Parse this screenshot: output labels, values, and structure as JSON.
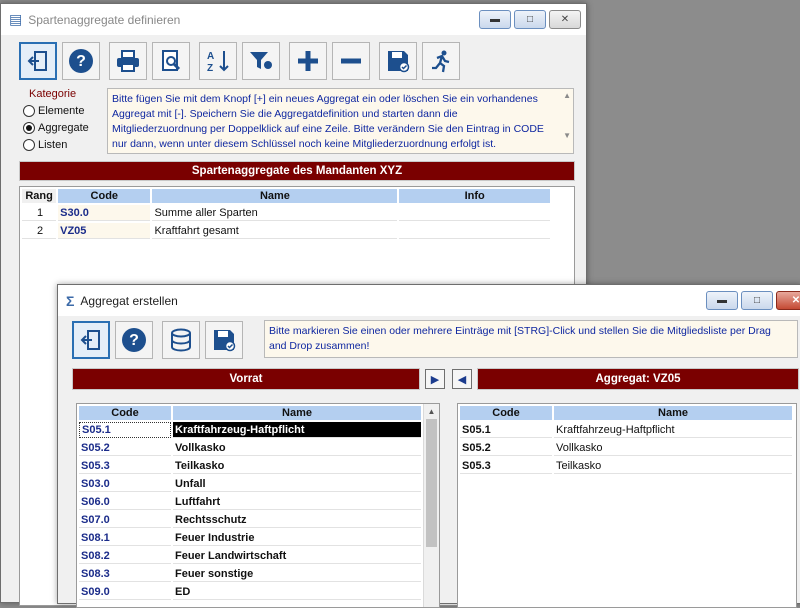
{
  "win1": {
    "title": "Spartenaggregate definieren",
    "help": "Bitte fügen Sie mit dem Knopf [+] ein neues Aggregat ein oder löschen Sie ein vorhandenes Aggregat mit [-]. Speichern Sie die Aggregatdefinition und starten dann die Mitgliederzuordnung per Doppelklick auf eine Zeile. Bitte verändern Sie den Eintrag in CODE nur dann, wenn unter diesem Schlüssel noch keine Mitgliederzuordnung erfolgt ist.",
    "kategorie": {
      "label": "Kategorie",
      "options": [
        "Elemente",
        "Aggregate",
        "Listen"
      ],
      "selected": "Aggregate"
    },
    "header": "Spartenaggregate des Mandanten XYZ",
    "columns": [
      "Rang",
      "Code",
      "Name",
      "Info"
    ],
    "rows": [
      {
        "rang": "1",
        "code": "S30.0",
        "name": "Summe aller Sparten",
        "info": ""
      },
      {
        "rang": "2",
        "code": "VZ05",
        "name": "Kraftfahrt gesamt",
        "info": ""
      }
    ]
  },
  "win2": {
    "title": "Aggregat erstellen",
    "help": "Bitte markieren Sie einen oder mehrere Einträge mit [STRG]-Click und stellen Sie die Mitgliedsliste per Drag and Drop zusammen!",
    "left_header": "Vorrat",
    "right_header": "Aggregat: VZ05",
    "columns": [
      "Code",
      "Name"
    ],
    "vorrat": [
      {
        "code": "S05.1",
        "name": "Kraftfahrzeug-Haftpflicht"
      },
      {
        "code": "S05.2",
        "name": "Vollkasko"
      },
      {
        "code": "S05.3",
        "name": "Teilkasko"
      },
      {
        "code": "S03.0",
        "name": "Unfall"
      },
      {
        "code": "S06.0",
        "name": "Luftfahrt"
      },
      {
        "code": "S07.0",
        "name": "Rechtsschutz"
      },
      {
        "code": "S08.1",
        "name": "Feuer Industrie"
      },
      {
        "code": "S08.2",
        "name": "Feuer Landwirtschaft"
      },
      {
        "code": "S08.3",
        "name": "Feuer sonstige"
      },
      {
        "code": "S09.0",
        "name": "ED"
      }
    ],
    "aggregat": [
      {
        "code": "S05.1",
        "name": "Kraftfahrzeug-Haftpflicht"
      },
      {
        "code": "S05.2",
        "name": "Vollkasko"
      },
      {
        "code": "S05.3",
        "name": "Teilkasko"
      }
    ]
  },
  "colors": {
    "header_bar": "#7a0000",
    "column_header": "#b4cff0",
    "code_text": "#1b2c8a",
    "help_text": "#0f27a0"
  }
}
